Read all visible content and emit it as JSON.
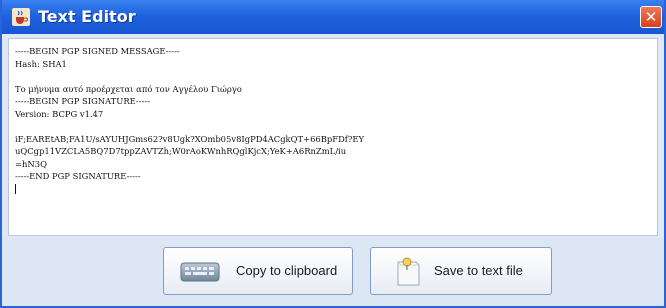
{
  "window": {
    "title": "Text Editor",
    "icons": {
      "app": "java-cup-icon",
      "close": "close-icon"
    },
    "colors": {
      "titlebar": "#1f62df",
      "close": "#d5401e",
      "panel": "#dfe8f6"
    }
  },
  "editor": {
    "lines": [
      "-----BEGIN PGP SIGNED MESSAGE-----",
      "Hash: SHA1",
      "",
      "Το μήνυμα αυτό προέρχεται από τον Αγγέλου Γιώργο",
      "-----BEGIN PGP SIGNATURE-----",
      "Version: BCPG v1.47",
      "",
      "iF;EAREtAB;FA1U/sAYUHJGms62?v8Ugk?XOmb05v8IgPD4ACgkQT+66BpFDf?EY",
      "uQCgp11VZCLA5BQ7D7tppZAVTZh;W0rAoKWnhRQglKjcX;YeK+A6RnZmL/iu",
      "=hN3Q",
      "-----END PGP SIGNATURE-----",
      ""
    ]
  },
  "buttons": {
    "copy_label": "Copy to clipboard",
    "copy_icon": "keyboard-icon",
    "save_label": "Save to text file",
    "save_icon": "note-pin-icon"
  }
}
